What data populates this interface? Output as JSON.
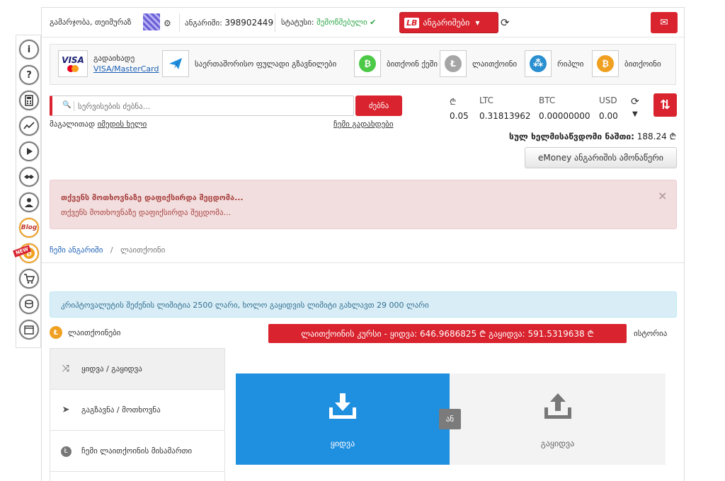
{
  "topbar": {
    "greeting": "გამარჯობა, თეიმურაზ",
    "account_label": "ანგარიში:",
    "account_number": "398902449",
    "status_label": "სტატუსი:",
    "status_value": "შემოწმებული",
    "accounts_button": "ანგარიშები",
    "logo_text": "LB"
  },
  "methods": [
    {
      "label_top": "გადაიხადე",
      "label_link": "VISA/MasterCard"
    },
    {
      "label": "საერთაშორისო ფულადი გზავნილები"
    },
    {
      "label": "ბითქოინ ქეში"
    },
    {
      "label": "ლაითქოინი"
    },
    {
      "label": "რიპლი"
    },
    {
      "label": "ბითქოინი"
    }
  ],
  "search": {
    "placeholder": "სერვისების ძებნა...",
    "button": "ძებნა",
    "link_left_prefix": "მაგალითად ",
    "link_left": "იმედის ხელი",
    "link_right": "ჩემი გადახდები"
  },
  "balances": {
    "gel_symbol": "₾",
    "gel_value": "0.05",
    "ltc_label": "LTC",
    "ltc_value": "0.31813962",
    "btc_label": "BTC",
    "btc_value": "0.00000000",
    "usd_label": "USD",
    "usd_value": "0.00",
    "total_label": "სულ ხელმისაწვდომი ნაშთი:",
    "total_value": "188.24 ₾",
    "emoney_button": "eMoney ანგარიშის ამონაწერი"
  },
  "alert": {
    "title": "თქვენს მოთხოვნაზე დაფიქსირდა შეცდომა...",
    "text": "თქვენს მოთხოვნაზე დაფიქსირდა შეცდომა..."
  },
  "breadcrumb": {
    "home": "ჩემი ანგარიში",
    "separator": "/",
    "current": "ლაითქოინი"
  },
  "info": "კრიპტოვალუტის შეძენის ლიმიტია 2500 ლარი, ხოლო გაყიდვის ლიმიტი გახლავთ 29 000 ლარი",
  "litecoin": {
    "title": "ლაითქოინები",
    "rate_text": "ლაითქოინის კურსი - ყიდვა: 646.9686825 ₾   გაყიდვა: 591.5319638 ₾",
    "history": "ისტორია"
  },
  "side_menu": [
    {
      "label": "ყიდვა / გაყიდვა",
      "icon": "shuffle-icon"
    },
    {
      "label": "გაგზავნა / მოთხოვნა",
      "icon": "send-icon"
    },
    {
      "label": "ჩემი ლაითქოინის მისამართი",
      "icon": "litecoin-icon"
    }
  ],
  "trade": {
    "buy": "ყიდვა",
    "sell": "გაყიდვა",
    "or": "ან"
  },
  "colors": {
    "accent": "#d9232e",
    "buy_tile": "#1f8fe0",
    "status_ok": "#2ea84a"
  }
}
